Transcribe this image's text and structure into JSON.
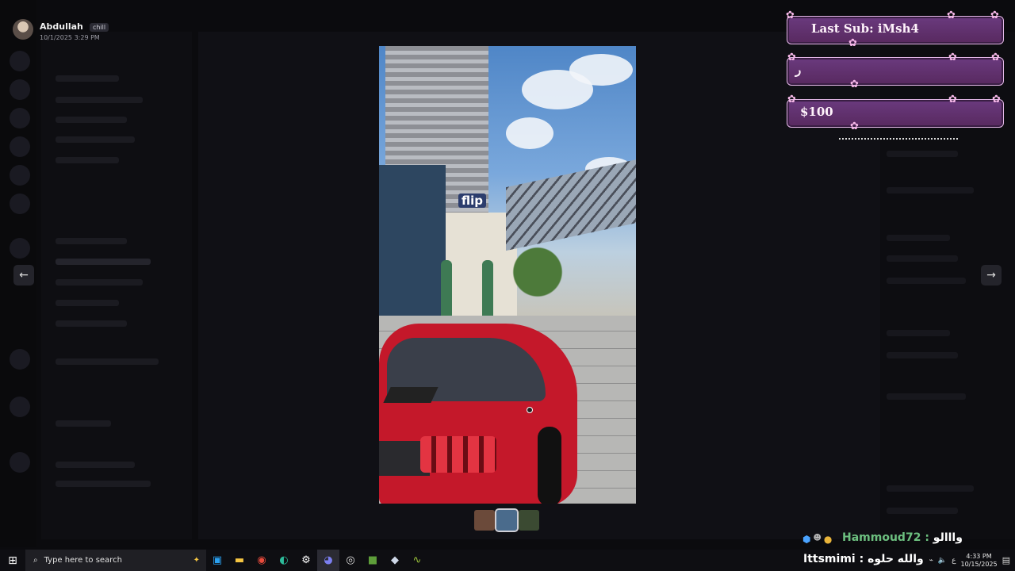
{
  "viewer": {
    "user_name": "Abdullah",
    "badge": "chill",
    "timestamp": "10/1/2025 3:29 PM",
    "prev_icon": "arrow-left-icon",
    "next_icon": "arrow-right-icon",
    "photo_sign_text": "flip",
    "thumbnails": [
      {
        "color": "#6b4a3a"
      },
      {
        "color": "#4a6b8c",
        "selected": true
      },
      {
        "color": "#3b4a32"
      }
    ]
  },
  "stream_overlay": {
    "last_sub_label": "Last Sub: iMsh4",
    "middle_text": "ر",
    "amount": "$100",
    "chat_user": "Hammoud72",
    "chat_message": "وااالو",
    "footer_name": "Ittsmimi",
    "footer_message": "والله حلوه"
  },
  "taskbar": {
    "search_placeholder": "Type here to search",
    "icons": [
      "copilot-icon",
      "store-icon",
      "file-explorer-icon",
      "chrome-icon",
      "edge-icon",
      "settings-icon",
      "discord-icon",
      "obs-icon",
      "minecraft-icon",
      "cube-icon",
      "snake-icon"
    ],
    "active_icon": "discord-icon",
    "time": "4:33 PM",
    "date": "10/15/2025",
    "lang": "ع"
  }
}
